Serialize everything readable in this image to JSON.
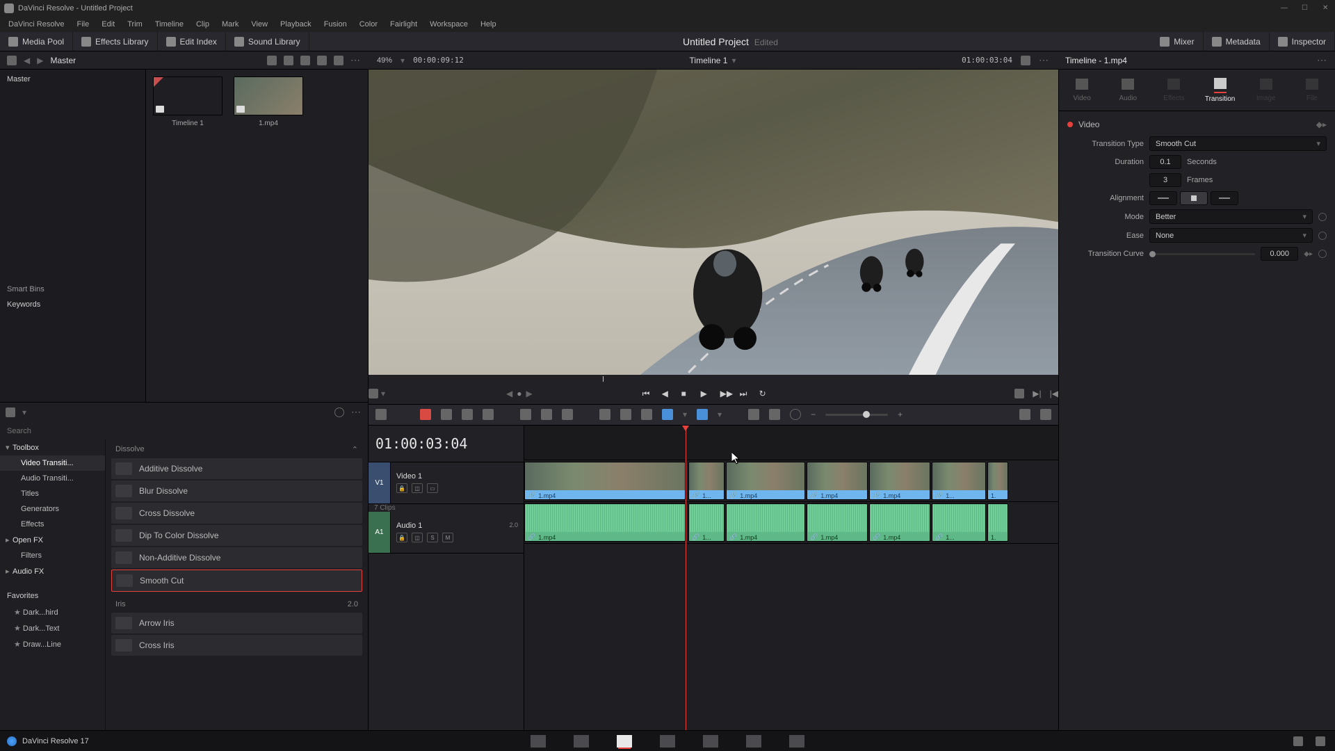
{
  "window": {
    "title": "DaVinci Resolve - Untitled Project"
  },
  "menubar": [
    "DaVinci Resolve",
    "File",
    "Edit",
    "Trim",
    "Timeline",
    "Clip",
    "Mark",
    "View",
    "Playback",
    "Fusion",
    "Color",
    "Fairlight",
    "Workspace",
    "Help"
  ],
  "toolbar": {
    "media_pool": "Media Pool",
    "effects_library": "Effects Library",
    "edit_index": "Edit Index",
    "sound_library": "Sound Library",
    "mixer": "Mixer",
    "metadata": "Metadata",
    "inspector": "Inspector"
  },
  "project": {
    "title": "Untitled Project",
    "status": "Edited"
  },
  "secbar": {
    "master": "Master",
    "zoom": "49%",
    "source_tc": "00:00:09:12",
    "timeline_name": "Timeline 1",
    "record_tc": "01:00:03:04",
    "clip_name": "Timeline - 1.mp4"
  },
  "media_tree": {
    "master": "Master",
    "smart_bins": "Smart Bins",
    "keywords": "Keywords"
  },
  "thumbs": [
    {
      "label": "Timeline 1",
      "type": "timeline"
    },
    {
      "label": "1.mp4",
      "type": "clip"
    }
  ],
  "fx": {
    "search_placeholder": "Search",
    "tree": {
      "toolbox": "Toolbox",
      "video_transitions": "Video Transiti...",
      "audio_transitions": "Audio Transiti...",
      "titles": "Titles",
      "generators": "Generators",
      "effects": "Effects",
      "open_fx": "Open FX",
      "filters": "Filters",
      "audio_fx": "Audio FX"
    },
    "favorites": "Favorites",
    "fav_items": [
      "Dark...hird",
      "Dark...Text",
      "Draw...Line"
    ],
    "categories": {
      "dissolve": "Dissolve",
      "iris": "Iris"
    },
    "dissolve_items": [
      "Additive Dissolve",
      "Blur Dissolve",
      "Cross Dissolve",
      "Dip To Color Dissolve",
      "Non-Additive Dissolve",
      "Smooth Cut"
    ],
    "iris_items": [
      "Arrow Iris",
      "Cross Iris"
    ],
    "iris_meta": "2.0"
  },
  "timeline": {
    "head_tc": "01:00:03:04",
    "v1": "V1",
    "video1": "Video 1",
    "a1": "A1",
    "audio1": "Audio 1",
    "clips_meta": "7 Clips",
    "audio_meta": "2.0",
    "clip_label": "1.mp4",
    "clip_short": "1...",
    "clip_shorter": "1."
  },
  "inspector": {
    "tabs": {
      "video": "Video",
      "audio": "Audio",
      "effects": "Effects",
      "transition": "Transition",
      "image": "Image",
      "file": "File"
    },
    "section": "Video",
    "rows": {
      "transition_type": "Transition Type",
      "transition_type_val": "Smooth Cut",
      "duration": "Duration",
      "duration_sec": "0.1",
      "seconds": "Seconds",
      "duration_frames": "3",
      "frames": "Frames",
      "alignment": "Alignment",
      "mode": "Mode",
      "mode_val": "Better",
      "ease": "Ease",
      "ease_val": "None",
      "transition_curve": "Transition Curve",
      "curve_val": "0.000"
    }
  },
  "brand": "DaVinci Resolve 17"
}
